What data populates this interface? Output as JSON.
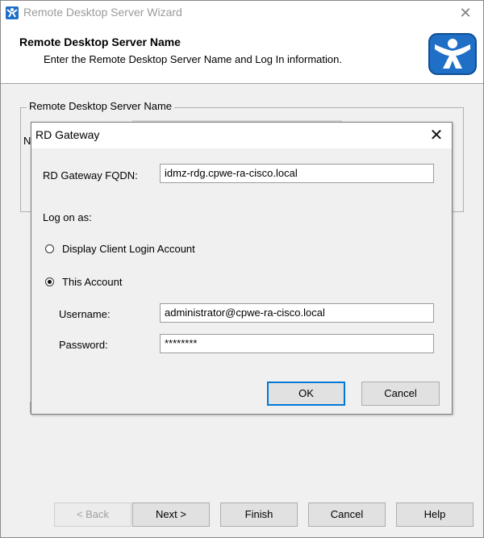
{
  "window": {
    "title": "Remote Desktop Server Wizard",
    "close_glyph": "✕",
    "app_icon": "thinmanager-icon"
  },
  "header": {
    "title": "Remote Desktop Server Name",
    "subtitle": "Enter the Remote Desktop Server Name and Log In information.",
    "logo": "thinmanager-logo",
    "accent_color": "#1f6fc7"
  },
  "background": {
    "groupbox_label": "Remote Desktop Server Name",
    "partial_text": "N"
  },
  "dialog": {
    "title": "RD Gateway",
    "close_glyph": "✕",
    "fqdn_label": "RD Gateway FQDN:",
    "fqdn_value": "idmz-rdg.cpwe-ra-cisco.local",
    "logon_label": "Log on as:",
    "radio_display": "Display Client Login Account",
    "radio_this": "This Account",
    "username_label": "Username:",
    "username_value": "administrator@cpwe-ra-cisco.local",
    "password_label": "Password:",
    "password_value": "********",
    "ok_label": "OK",
    "cancel_label": "Cancel"
  },
  "footer": {
    "back_label": "< Back",
    "next_label": "Next >",
    "finish_label": "Finish",
    "cancel_label": "Cancel",
    "help_label": "Help"
  }
}
